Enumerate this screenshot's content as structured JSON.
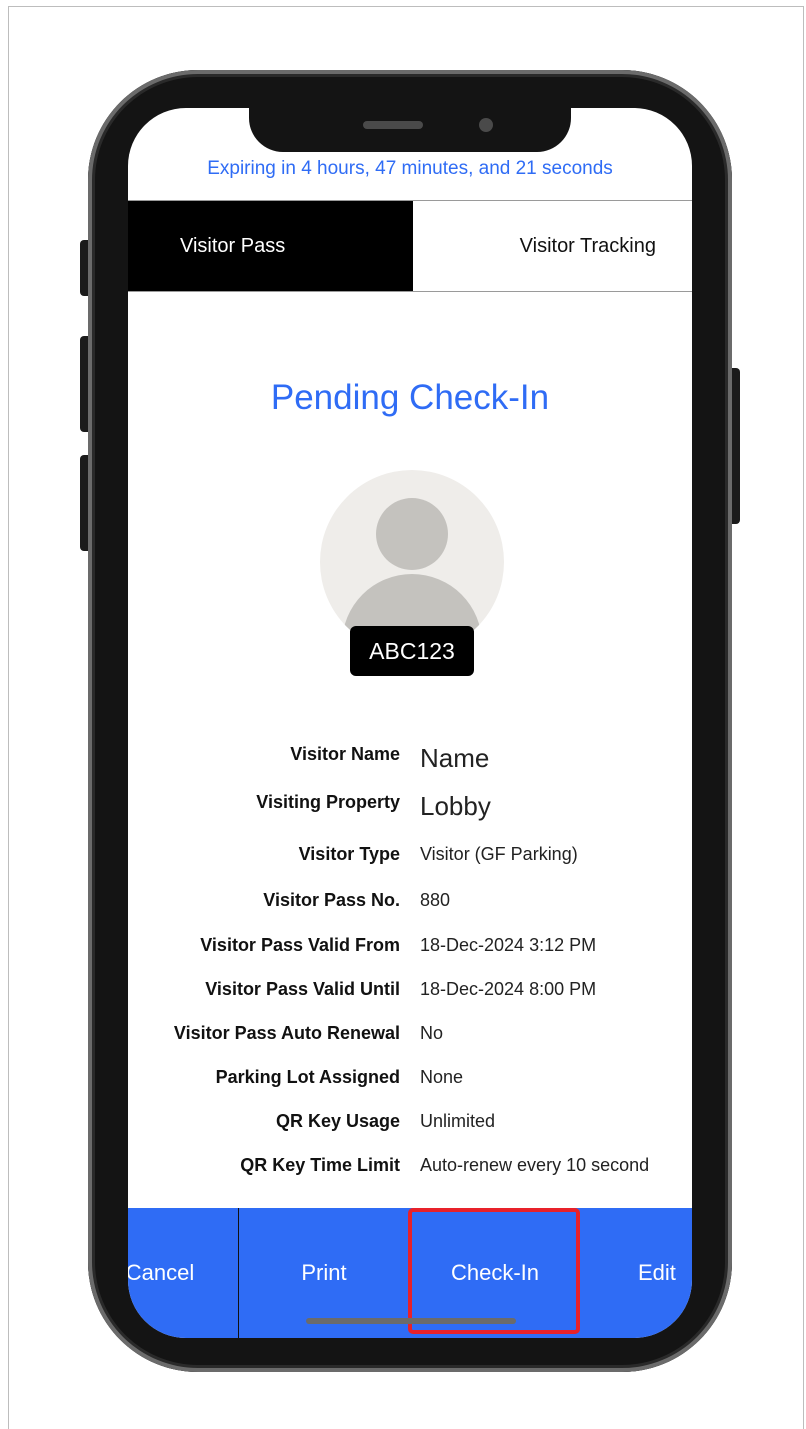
{
  "header": {
    "expiry_text": "Expiring in 4 hours, 47 minutes, and 21 seconds"
  },
  "tabs": [
    {
      "label": "Visitor Pass",
      "active": true
    },
    {
      "label": "Visitor Tracking",
      "active": false
    }
  ],
  "status": {
    "title": "Pending Check-In"
  },
  "avatar": {
    "icon": "person-placeholder-icon",
    "plate": "ABC123"
  },
  "details": [
    {
      "label": "Visitor Name",
      "value": "Name"
    },
    {
      "label": "Visiting Property",
      "value": "Lobby"
    },
    {
      "label": "Visitor Type",
      "value": "Visitor (GF Parking)"
    },
    {
      "label": "Visitor Pass No.",
      "value": "880"
    },
    {
      "label": "Visitor Pass Valid From",
      "value": "18-Dec-2024 3:12 PM"
    },
    {
      "label": "Visitor Pass Valid Until",
      "value": "18-Dec-2024 8:00 PM"
    },
    {
      "label": "Visitor Pass Auto Renewal",
      "value": "No"
    },
    {
      "label": "Parking Lot Assigned",
      "value": "None"
    },
    {
      "label": "QR Key Usage",
      "value": "Unlimited"
    },
    {
      "label": "QR Key Time Limit",
      "value": "Auto-renew every 10 second"
    }
  ],
  "actions": {
    "cancel": "Cancel",
    "print": "Print",
    "checkin": "Check-In",
    "edit": "Edit"
  },
  "colors": {
    "accent": "#2f6cf5",
    "highlight": "#e8212a",
    "tab_active_bg": "#000000"
  }
}
